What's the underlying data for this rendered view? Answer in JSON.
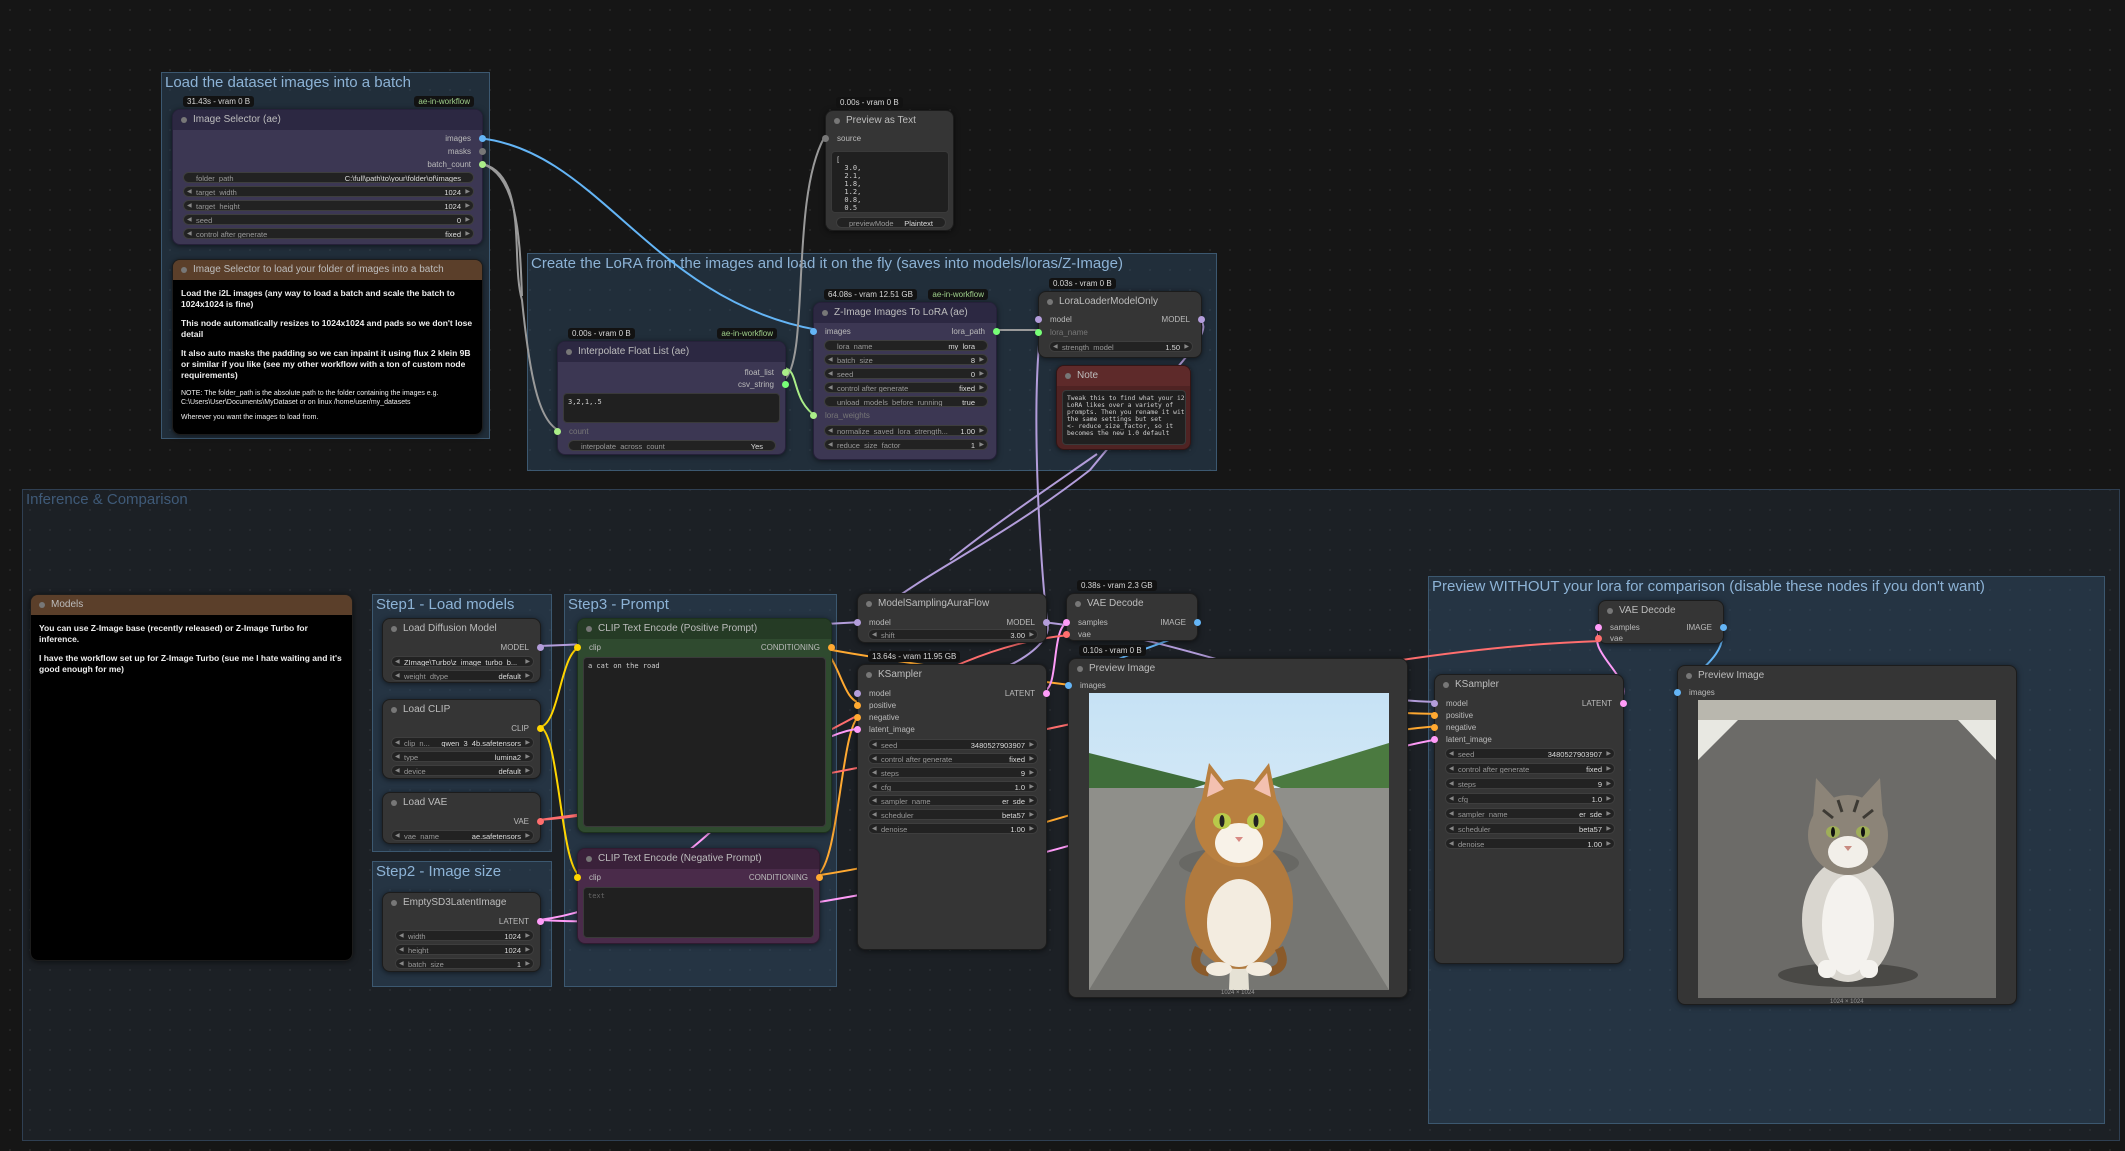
{
  "groups": {
    "load_dataset": "Load the dataset images into a batch",
    "create_lora": "Create the LoRA from the images and load it on the fly (saves into models/loras/Z-Image)",
    "inference": "Inference & Comparison",
    "step1": "Step1 - Load models",
    "step2": "Step2 - Image size",
    "step3": "Step3 - Prompt",
    "preview_without": "Preview WITHOUT your lora for comparison (disable these nodes if you don't want)"
  },
  "image_selector": {
    "badge": "31.43s - vram 0 B",
    "badge2": "ae-in-workflow",
    "title": "Image Selector (ae)",
    "outputs": [
      "images",
      "masks",
      "batch_count"
    ],
    "widgets": [
      {
        "label": "folder_path",
        "value": "C:\\full\\path\\to\\your\\folder\\of\\images"
      },
      {
        "label": "target_width",
        "value": "1024"
      },
      {
        "label": "target_height",
        "value": "1024"
      },
      {
        "label": "seed",
        "value": "0"
      },
      {
        "label": "control after generate",
        "value": "fixed"
      }
    ]
  },
  "note_loader": {
    "title": "Image Selector to load your folder of images into a batch",
    "p1": "Load the i2L images (any way to load a batch and scale the batch to 1024x1024 is fine)",
    "p2": "This node automatically resizes to 1024x1024 and pads so we don't lose detail",
    "p3": "It also auto masks the padding so we can inpaint it using flux 2 klein 9B or similar if you like (see my other workflow with a ton of custom node requirements)",
    "p4": "NOTE: The folder_path is the absolute path to the folder containing the images e.g. C:\\Users\\User\\Documents\\MyDataset or on linux /home/user/my_datasets",
    "p5": "Wherever you want the images to load from."
  },
  "preview_text": {
    "badge": "0.00s - vram 0 B",
    "title": "Preview as Text",
    "input": "source",
    "content": "[\n  3.0,\n  2.1,\n  1.8,\n  1.2,\n  0.8,\n  0.5\n]",
    "mode_label": "previewMode",
    "mode_value": "Plaintext"
  },
  "interp": {
    "badge": "0.00s - vram 0 B",
    "badge2": "ae-in-workflow",
    "title": "Interpolate Float List (ae)",
    "outputs": [
      "float_list",
      "csv_string"
    ],
    "text": "3,2,1,.5",
    "count": "count",
    "widget_label": "interpolate_across_count",
    "widget_value": "Yes"
  },
  "zimage_lora": {
    "badge": "64.08s - vram 12.51 GB",
    "badge2": "ae-in-workflow",
    "title": "Z-Image Images To LoRA (ae)",
    "input": "images",
    "output": "lora_path",
    "in2": "lora_weights",
    "widgets": [
      {
        "label": "lora_name",
        "value": "my_lora"
      },
      {
        "label": "batch_size",
        "value": "8"
      },
      {
        "label": "seed",
        "value": "0"
      },
      {
        "label": "control after generate",
        "value": "fixed"
      },
      {
        "label": "unload_models_before_running",
        "value": "true"
      },
      {
        "label": "normalize_saved_lora_strength...",
        "value": "1.00"
      },
      {
        "label": "reduce_size_factor",
        "value": "1"
      }
    ]
  },
  "lora_loader": {
    "badge": "0.03s - vram 0 B",
    "title": "LoraLoaderModelOnly",
    "input": "model",
    "in2": "lora_name",
    "output": "MODEL",
    "widget_label": "strength_model",
    "widget_value": "1.50"
  },
  "note_tweak": {
    "title": "Note",
    "text": "Tweak this to find what your i2L\nLoRA likes over a variety of\nprompts. Then you rename it with\nthe same settings but set\n<- reduce_size_factor, so it\nbecomes the new 1.0 default"
  },
  "models_note": {
    "title": "Models",
    "p1": "You can use Z-Image base (recently released) or Z-Image Turbo for inference.",
    "p2": "I have the workflow set up for Z-Image Turbo (sue me I hate waiting and it's good enough for me)"
  },
  "load_diffusion": {
    "title": "Load Diffusion Model",
    "output": "MODEL",
    "widgets": [
      {
        "label": "",
        "value": "ZImage\\Turbo\\z_image_turbo_b..."
      },
      {
        "label": "weight_dtype",
        "value": "default"
      }
    ]
  },
  "load_clip": {
    "title": "Load CLIP",
    "output": "CLIP",
    "widgets": [
      {
        "label": "clip_n...",
        "value": "qwen_3_4b.safetensors"
      },
      {
        "label": "type",
        "value": "lumina2"
      },
      {
        "label": "device",
        "value": "default"
      }
    ]
  },
  "load_vae": {
    "title": "Load VAE",
    "output": "VAE",
    "widgets": [
      {
        "label": "vae_name",
        "value": "ae.safetensors"
      }
    ]
  },
  "empty_latent": {
    "title": "EmptySD3LatentImage",
    "output": "LATENT",
    "widgets": [
      {
        "label": "width",
        "value": "1024"
      },
      {
        "label": "height",
        "value": "1024"
      },
      {
        "label": "batch_size",
        "value": "1"
      }
    ]
  },
  "clip_pos": {
    "title": "CLIP Text Encode (Positive Prompt)",
    "input": "clip",
    "output": "CONDITIONING",
    "text": "a cat on the road"
  },
  "clip_neg": {
    "title": "CLIP Text Encode (Negative Prompt)",
    "input": "clip",
    "output": "CONDITIONING",
    "placeholder": "text"
  },
  "model_sampling": {
    "title": "ModelSamplingAuraFlow",
    "input": "model",
    "output": "MODEL",
    "widget_label": "shift",
    "widget_value": "3.00"
  },
  "ksampler1": {
    "badge": "13.64s - vram 11.95 GB",
    "title": "KSampler",
    "inputs": [
      "model",
      "positive",
      "negative",
      "latent_image"
    ],
    "output": "LATENT",
    "widgets": [
      {
        "label": "seed",
        "value": "3480527903907"
      },
      {
        "label": "control after generate",
        "value": "fixed"
      },
      {
        "label": "steps",
        "value": "9"
      },
      {
        "label": "cfg",
        "value": "1.0"
      },
      {
        "label": "sampler_name",
        "value": "er_sde"
      },
      {
        "label": "scheduler",
        "value": "beta57"
      },
      {
        "label": "denoise",
        "value": "1.00"
      }
    ]
  },
  "vae_decode1": {
    "badge": "0.38s - vram 2.3 GB",
    "title": "VAE Decode",
    "inputs": [
      "samples",
      "vae"
    ],
    "output": "IMAGE"
  },
  "preview1": {
    "badge": "0.10s - vram 0 B",
    "title": "Preview Image",
    "input": "images",
    "caption": "1024 × 1024"
  },
  "vae_decode2": {
    "title": "VAE Decode",
    "inputs": [
      "samples",
      "vae"
    ],
    "output": "IMAGE"
  },
  "ksampler2": {
    "title": "KSampler",
    "inputs": [
      "model",
      "positive",
      "negative",
      "latent_image"
    ],
    "output": "LATENT",
    "widgets": [
      {
        "label": "seed",
        "value": "3480527903907"
      },
      {
        "label": "control after generate",
        "value": "fixed"
      },
      {
        "label": "steps",
        "value": "9"
      },
      {
        "label": "cfg",
        "value": "1.0"
      },
      {
        "label": "sampler_name",
        "value": "er_sde"
      },
      {
        "label": "scheduler",
        "value": "beta57"
      },
      {
        "label": "denoise",
        "value": "1.00"
      }
    ]
  },
  "preview2": {
    "title": "Preview Image",
    "input": "images",
    "caption": "1024 × 1024"
  },
  "colors": {
    "model": "#b39ddb",
    "clip": "#ffd500",
    "conditioning": "#ffa931",
    "latent": "#ff9cf9",
    "vae": "#ff6e6e",
    "image": "#64b5f6",
    "float": "#aaee88",
    "string": "#77ff77",
    "generic": "#777777"
  }
}
